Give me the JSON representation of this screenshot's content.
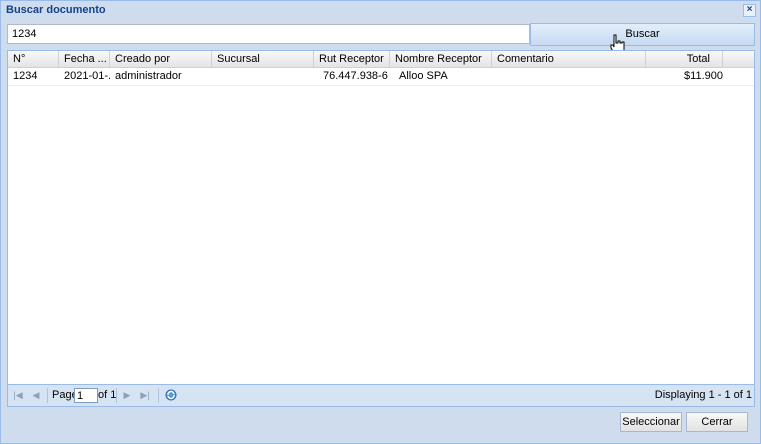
{
  "window": {
    "title": "Buscar documento",
    "close_glyph": "×"
  },
  "search": {
    "value": "1234",
    "button_label": "Buscar"
  },
  "grid": {
    "columns": [
      "N°",
      "Fecha ...",
      "Creado por",
      "Sucursal",
      "Rut Receptor",
      "Nombre Receptor",
      "Comentario",
      "Total"
    ],
    "rows": [
      {
        "n": "1234",
        "fecha": "2021-01-...",
        "creado_por": "administrador",
        "sucursal": "",
        "rut": "76.447.938-6",
        "nombre": "Alloo SPA",
        "comentario": "",
        "total": "$11.900"
      }
    ]
  },
  "pager": {
    "page_label": "Page",
    "page_value": "1",
    "of_label": "of 1",
    "display_text": "Displaying 1 - 1 of 1"
  },
  "footer": {
    "select_label": "Seleccionar",
    "close_label": "Cerrar"
  },
  "icons": {
    "first": "first-page-icon",
    "prev": "prev-page-icon",
    "next": "next-page-icon",
    "last": "last-page-icon",
    "refresh": "refresh-icon",
    "cursor": "hand-cursor-icon"
  },
  "colors": {
    "title": "#15428b",
    "frame": "#cfdced",
    "border": "#99bbe8"
  }
}
